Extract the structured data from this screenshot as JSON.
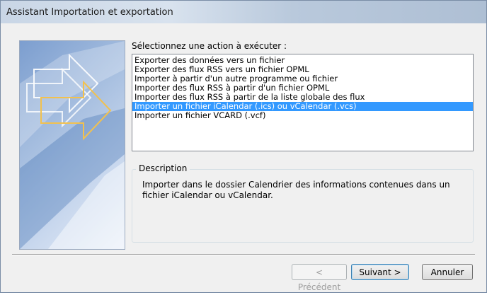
{
  "window": {
    "title": "Assistant Importation et exportation"
  },
  "prompt": "Sélectionnez une action à exécuter :",
  "actions": [
    "Exporter des données vers un fichier",
    "Exporter des flux RSS vers un fichier OPML",
    "Importer à partir d'un autre programme ou fichier",
    "Importer des flux RSS à partir d'un fichier OPML",
    "Importer des flux RSS à partir de la liste globale des flux",
    "Importer un fichier iCalendar (.ics) ou vCalendar (.vcs)",
    "Importer un fichier VCARD (.vcf)"
  ],
  "selected_index": 5,
  "description": {
    "label": "Description",
    "text": "Importer dans le dossier Calendrier des informations contenues dans un fichier iCalendar ou vCalendar."
  },
  "buttons": {
    "back": "< Précédent",
    "next": "Suivant >",
    "cancel": "Annuler"
  },
  "colors": {
    "selection": "#3399ff",
    "banner_blue": "#7c9ecf",
    "arrow_outline": "#f2c14e"
  }
}
